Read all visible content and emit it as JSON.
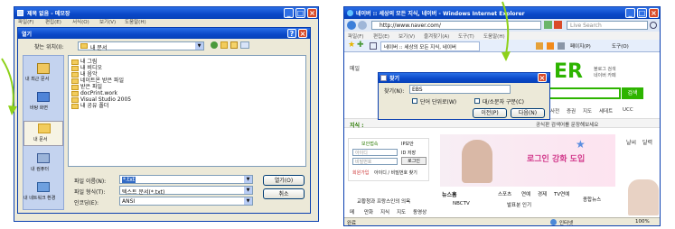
{
  "left": {
    "window_title": "제목 없음 - 메모장",
    "menu": [
      "파일(F)",
      "편집(E)",
      "서식(O)",
      "보기(V)",
      "도움말(H)"
    ],
    "dialog": {
      "title": "열기",
      "location_label": "찾는 위치(I):",
      "location_value": "내 문서",
      "places": [
        "내 최근 문서",
        "바탕 화면",
        "내 문서",
        "내 컴퓨터",
        "내 네트워크 환경"
      ],
      "files": [
        "내 그림",
        "내 비디오",
        "내 음악",
        "네이트온 받은 파일",
        "받은 파일",
        "docPrint.work",
        "Visual Studio 2005",
        "내 공유 폴더"
      ],
      "filename_label": "파일 이름(N):",
      "filename_value": "*.txt",
      "filetype_label": "파일 형식(T):",
      "filetype_value": "텍스트 문서(*.txt)",
      "encoding_label": "인코딩(E):",
      "encoding_value": "ANSI",
      "open_button": "열기(O)",
      "cancel_button": "취소"
    }
  },
  "right": {
    "window_title": "네이버 :: 세상의 모든 지식, 네이버 - Windows Internet Explorer",
    "address": "http://www.naver.com/",
    "search_placeholder": "Live Search",
    "menu": [
      "파일(F)",
      "편집(E)",
      "보기(V)",
      "즐겨찾기(A)",
      "도구(T)",
      "도움말(H)"
    ],
    "tab_label": "네이버 :: 세상의 모든 지식, 네이버",
    "toolbar_page": "페이지(P)",
    "toolbar_tools": "도구(O)",
    "logo_letters": "ER",
    "side_links": [
      "블로그 검색",
      "네이버 카페"
    ],
    "search_button": "검색",
    "nav_links": [
      "뉴스",
      "사전",
      "증권",
      "지도",
      "세데트",
      "UCC"
    ],
    "knowledge_label": "지식 :",
    "ad_text": "로그인 강화 도입",
    "promo_label": "공식판 검색어를 문장해보세요",
    "find_dialog": {
      "title": "찾기",
      "find_label": "찾기(N):",
      "find_value": "EBS",
      "whole_word": "단어 단위로(W)",
      "match_case": "대/소문자 구분(C)",
      "prev_button": "이전(P)",
      "next_button": "다음(N)"
    },
    "login": {
      "id_label": "보안접속",
      "ip_label": "IP보안",
      "id_placeholder": "아이디",
      "pw_placeholder": "비밀번호",
      "save_label": "ID 저장",
      "login_button": "로그인",
      "signup": "회원가입",
      "find_id": "아이디 / 비밀번호 찾기"
    },
    "side_widgets": [
      "날씨",
      "달력"
    ],
    "news_label": "뉴스홈",
    "news_tabs": [
      "스포츠",
      "연예",
      "경제",
      "TV연예"
    ],
    "news_items": [
      "교황청과 프랑스인의 의욕",
      "NBCTV",
      "발표분 인기"
    ],
    "news_more": "종합뉴스",
    "category_row": [
      "메",
      "만화",
      "지식",
      "지도",
      "동영상"
    ],
    "status_left": "완료",
    "status_zone": "인터넷",
    "zoom": "100%"
  }
}
